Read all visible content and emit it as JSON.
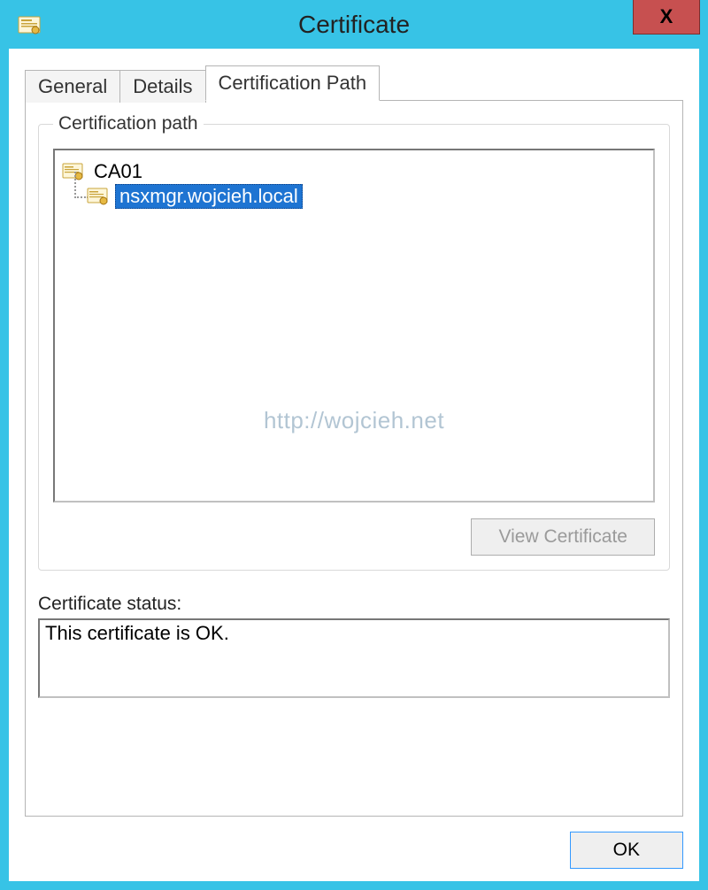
{
  "window": {
    "title": "Certificate",
    "close_glyph": "X"
  },
  "tabs": {
    "general": "General",
    "details": "Details",
    "certpath": "Certification Path"
  },
  "groupbox": {
    "legend": "Certification path"
  },
  "tree": {
    "root": "CA01",
    "child": "nsxmgr.wojcieh.local"
  },
  "watermark": "http://wojcieh.net",
  "buttons": {
    "view_certificate": "View Certificate",
    "ok": "OK"
  },
  "status": {
    "label": "Certificate status:",
    "value": "This certificate is OK."
  }
}
